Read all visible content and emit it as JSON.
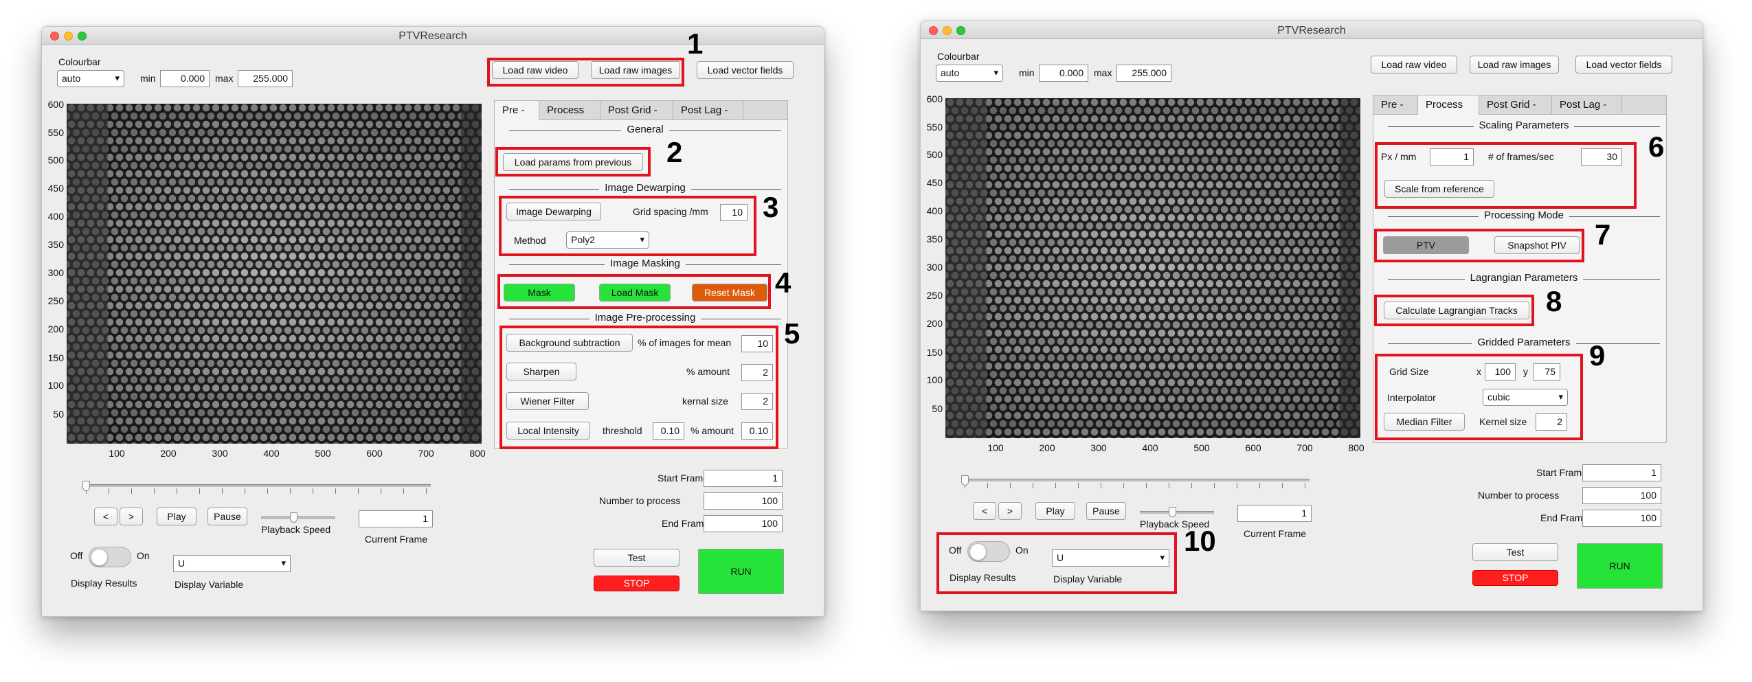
{
  "left": {
    "title": "PTVResearch",
    "colourbar": {
      "label": "Colourbar",
      "value": "auto",
      "min_label": "min",
      "min_value": "0.000",
      "max_label": "max",
      "max_value": "255.000"
    },
    "load": {
      "raw_video": "Load raw video",
      "raw_images": "Load raw images",
      "vector_fields": "Load vector fields"
    },
    "yticks": [
      "600",
      "550",
      "500",
      "450",
      "400",
      "350",
      "300",
      "250",
      "200",
      "150",
      "100",
      "50"
    ],
    "xticks": [
      "100",
      "200",
      "300",
      "400",
      "500",
      "600",
      "700",
      "800"
    ],
    "tabs": [
      "Pre -",
      "Process",
      "Post Grid -",
      "Post Lag -"
    ],
    "active_tab": "Pre -",
    "sections": {
      "general": "General",
      "dewarp": "Image Dewarping",
      "masking": "Image Masking",
      "preproc": "Image Pre-processing"
    },
    "load_params": "Load params from previous",
    "dewarp": {
      "button": "Image Dewarping",
      "grid_label": "Grid spacing /mm",
      "grid_value": "10",
      "method_label": "Method",
      "method_value": "Poly2"
    },
    "mask": {
      "mask": "Mask",
      "load": "Load Mask",
      "reset": "Reset Mask"
    },
    "preproc": {
      "bg_button": "Background subtraction",
      "bg_label": "% of images for mean",
      "bg_value": "10",
      "sharpen_button": "Sharpen",
      "sharpen_label": "% amount",
      "sharpen_value": "2",
      "wiener_button": "Wiener Filter",
      "wiener_label": "kernal size",
      "wiener_value": "2",
      "local_button": "Local Intensity",
      "threshold_label": "threshold",
      "threshold_value": "0.10",
      "amount_label": "% amount",
      "amount_value": "0.10"
    },
    "playback": {
      "prev": "<",
      "next": ">",
      "play": "Play",
      "pause": "Pause",
      "speed_label": "Playback Speed",
      "current_value": "1",
      "current_label": "Current Frame"
    },
    "frames": {
      "start_label": "Start Frame",
      "start_value": "1",
      "number_label": "Number to process",
      "number_value": "100",
      "end_label": "End Frame",
      "end_value": "100"
    },
    "display": {
      "off": "Off",
      "on": "On",
      "results_label": "Display Results",
      "variable_value": "U",
      "variable_label": "Display Variable"
    },
    "actions": {
      "test": "Test",
      "stop": "STOP",
      "run": "RUN"
    },
    "callouts": [
      "1",
      "2",
      "3",
      "4",
      "5"
    ]
  },
  "right": {
    "title": "PTVResearch",
    "colourbar": {
      "label": "Colourbar",
      "value": "auto",
      "min_label": "min",
      "min_value": "0.000",
      "max_label": "max",
      "max_value": "255.000"
    },
    "load": {
      "raw_video": "Load raw video",
      "raw_images": "Load raw images",
      "vector_fields": "Load vector fields"
    },
    "yticks": [
      "600",
      "550",
      "500",
      "450",
      "400",
      "350",
      "300",
      "250",
      "200",
      "150",
      "100",
      "50"
    ],
    "xticks": [
      "100",
      "200",
      "300",
      "400",
      "500",
      "600",
      "700",
      "800"
    ],
    "tabs": [
      "Pre -",
      "Process",
      "Post Grid -",
      "Post Lag -"
    ],
    "active_tab": "Process",
    "sections": {
      "scaling": "Scaling Parameters",
      "mode": "Processing Mode",
      "lagrangian": "Lagrangian Parameters",
      "gridded": "Gridded Parameters"
    },
    "scaling": {
      "px_label": "Px / mm",
      "px_value": "1",
      "fps_label": "# of frames/sec",
      "fps_value": "30",
      "scale_button": "Scale from reference"
    },
    "mode": {
      "ptv": "PTV",
      "piv": "Snapshot PIV"
    },
    "lagrangian_button": "Calculate Lagrangian Tracks",
    "gridded": {
      "grid_label": "Grid Size",
      "x_label": "x",
      "x_value": "100",
      "y_label": "y",
      "y_value": "75",
      "interp_label": "Interpolator",
      "interp_value": "cubic",
      "median_button": "Median Filter",
      "kernel_label": "Kernel size",
      "kernel_value": "2"
    },
    "playback": {
      "prev": "<",
      "next": ">",
      "play": "Play",
      "pause": "Pause",
      "speed_label": "Playback Speed",
      "current_value": "1",
      "current_label": "Current Frame"
    },
    "frames": {
      "start_label": "Start Frame",
      "start_value": "1",
      "number_label": "Number to process",
      "number_value": "100",
      "end_label": "End Frame",
      "end_value": "100"
    },
    "display": {
      "off": "Off",
      "on": "On",
      "results_label": "Display Results",
      "variable_value": "U",
      "variable_label": "Display Variable"
    },
    "actions": {
      "test": "Test",
      "stop": "STOP",
      "run": "RUN"
    },
    "callouts": [
      "6",
      "7",
      "8",
      "9",
      "10"
    ]
  },
  "colors": {
    "highlight": "#e0131e",
    "green": "#26e33a",
    "orange": "#dd5b0a",
    "red": "#ff1e1e",
    "ptv_gray": "#9b9b9b"
  },
  "icons": {
    "dropdown": "chevron-down-icon"
  }
}
